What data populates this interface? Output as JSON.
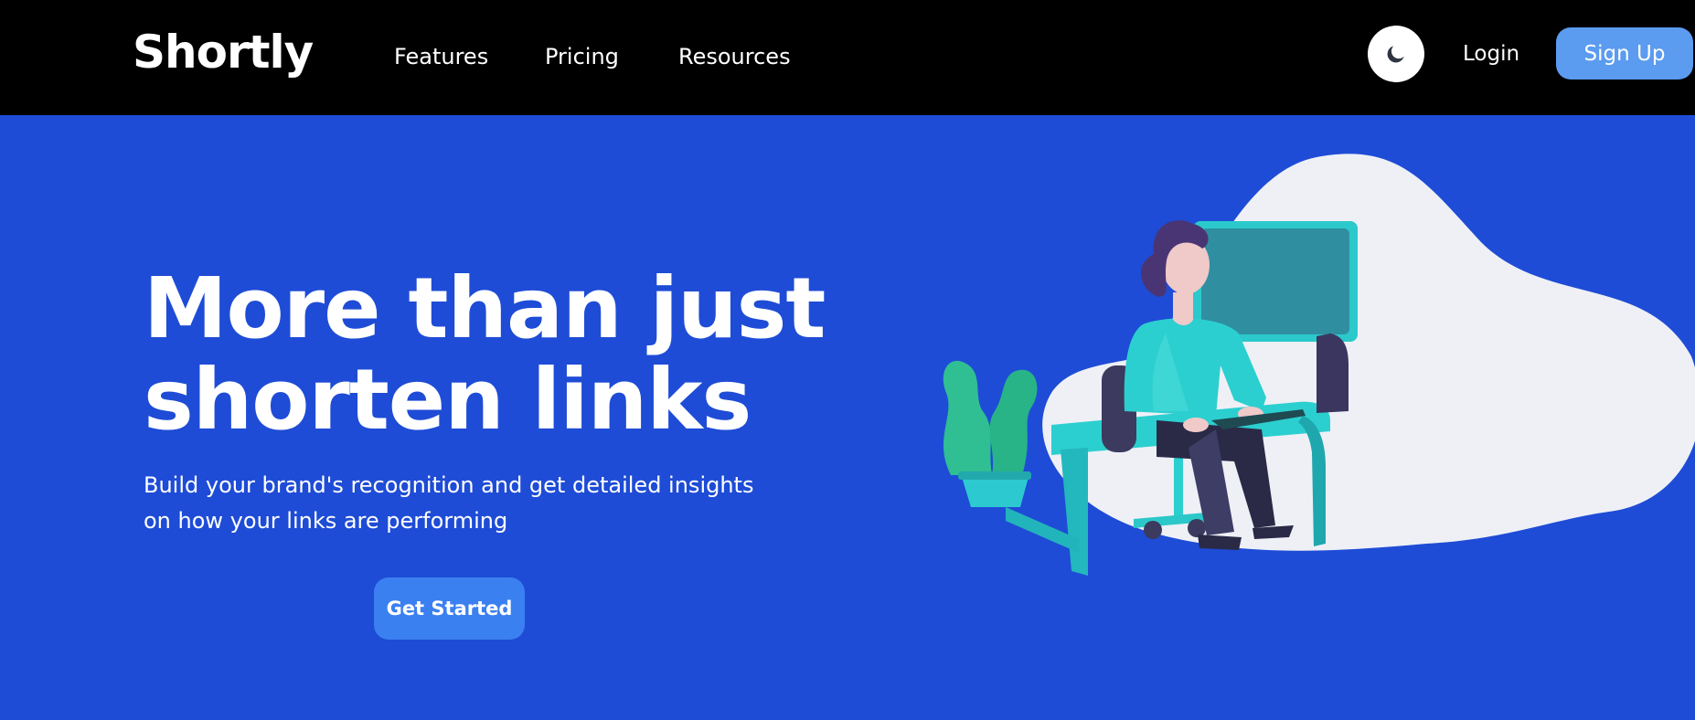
{
  "header": {
    "brand": "Shortly",
    "nav": [
      {
        "label": "Features"
      },
      {
        "label": "Pricing"
      },
      {
        "label": "Resources"
      }
    ],
    "theme_toggle_icon": "moon-icon",
    "login_label": "Login",
    "signup_label": "Sign Up"
  },
  "hero": {
    "title": "More than just shorten links",
    "subtitle": "Build your brand's recognition and get detailed insights on how your links are performing",
    "cta_label": "Get Started"
  },
  "colors": {
    "navbar_bg": "#000000",
    "hero_bg": "#1e4cd6",
    "signup_bg": "#5b9bf0",
    "cta_bg": "#3b80f0"
  }
}
